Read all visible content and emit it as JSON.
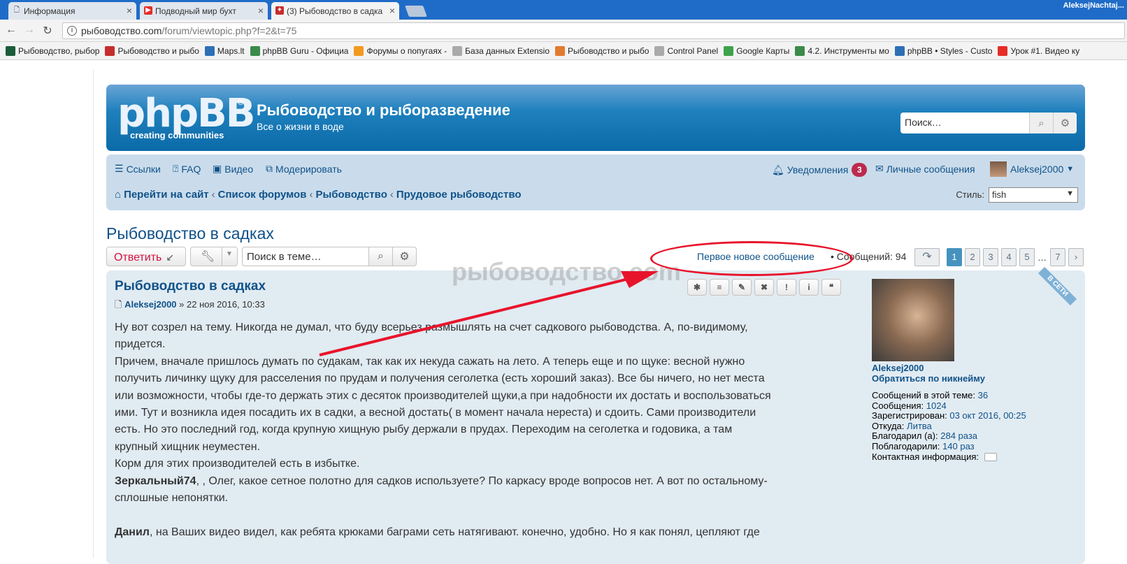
{
  "browser": {
    "tabs": [
      {
        "title": "Информация"
      },
      {
        "title": "Подводный мир бухт"
      },
      {
        "title": "(3) Рыбоводство в садка"
      }
    ],
    "profile_name": "AleksejNachtaj...",
    "url_domain": "рыбоводство.com",
    "url_path": "/forum/viewtopic.php?f=2&t=75"
  },
  "bookmarks": [
    {
      "label": "Рыбоводство, рыбор",
      "color": "#1a5c3a"
    },
    {
      "label": "Рыбоводство и рыбо",
      "color": "#c62d2d"
    },
    {
      "label": "Maps.lt",
      "color": "#2d6fb5"
    },
    {
      "label": "phpBB Guru - Официа",
      "color": "#3a8a4a"
    },
    {
      "label": "Форумы о попугаях -",
      "color": "#f39a1e"
    },
    {
      "label": "База данных Extensio",
      "color": "#aaaaaa"
    },
    {
      "label": "Рыбоводство и рыбо",
      "color": "#e27b2e"
    },
    {
      "label": "Control Panel",
      "color": "#aaaaaa"
    },
    {
      "label": "Google Карты",
      "color": "#3ca34a"
    },
    {
      "label": "4.2. Инструменты мо",
      "color": "#3a8a4a"
    },
    {
      "label": "phpBB • Styles - Custo",
      "color": "#2d6fb5"
    },
    {
      "label": "Урок #1. Видео ку",
      "color": "#e52d27"
    }
  ],
  "header": {
    "logo_text": "phpBB",
    "logo_reg": "®",
    "logo_tagline": "creating communities",
    "site_title": "Рыбоводство и рыборазведение",
    "site_description": "Все о жизни в воде",
    "search_placeholder": "Поиск…"
  },
  "navbar": {
    "links": [
      {
        "label": "Ссылки"
      },
      {
        "label": "FAQ"
      },
      {
        "label": "Видео"
      },
      {
        "label": "Модерировать"
      }
    ],
    "notifications_label": "Уведомления",
    "notifications_count": "3",
    "pm_label": "Личные сообщения",
    "username": "Aleksej2000",
    "breadcrumbs": [
      {
        "label": "Перейти на сайт"
      },
      {
        "label": "Список форумов"
      },
      {
        "label": "Рыбоводство"
      },
      {
        "label": "Прудовое рыбоводство"
      }
    ],
    "style_label": "Стиль:",
    "style_value": "fish"
  },
  "topic": {
    "title": "Рыбоводство в садках",
    "reply_label": "Ответить",
    "search_placeholder": "Поиск в теме…",
    "first_new_label": "Первое новое сообщение",
    "bullet": "•",
    "count_label": "Сообщений: 94",
    "pages": [
      "1",
      "2",
      "3",
      "4",
      "5",
      "…",
      "7"
    ],
    "watermark": "рыбоводство.com"
  },
  "post": {
    "title": "Рыбоводство в садках",
    "author": "Aleksej2000",
    "date": "» 22 ноя 2016, 10:33",
    "buttons": [
      "✱",
      "≡",
      "✎",
      "✖",
      "!",
      "i",
      "❝"
    ],
    "lines": [
      "Ну вот созрел на тему. Никогда не думал, что буду всерьез размышлять на счет садкового рыбоводства. А, по-видимому,",
      "придется.",
      "Причем, вначале пришлось думать по судакам, так как их некуда сажать на лето. А теперь еще и по щуке: весной нужно",
      "получить личинку щуку для расселения по прудам и получения сеголетка (есть хороший заказ). Все бы ничего, но нет места",
      "или возможности, чтобы где-то держать этих с десяток производителей щуки,а при надобности их достать и воспользоваться",
      "ими. Тут и возникла идея посадить их в садки, а весной достать( в момент начала нереста) и сдоить. Сами производители",
      "есть. Но это последний год, когда крупную хищную рыбу держали в прудах. Переходим на сеголетка и годовика, а там",
      "крупный хищник неуместен.",
      "Корм для этих производителей есть в избытке."
    ],
    "bold_1": "Зеркальный74",
    "line_bold_1": ", , Олег, какое сетное полотно для садков используете? По каркасу вроде вопросов нет. А вот по остальному-",
    "line_after_bold_1": "сплошные непонятки.",
    "bold_2": "Данил",
    "line_bold_2": ", на Ваших видео видел, как ребята крюками баграми сеть натягивают. конечно, удобно. Но я как понял, цепляют где"
  },
  "profile": {
    "online_badge": "В СЕТИ",
    "username": "Aleksej2000",
    "contact_link": "Обратиться по никнейму",
    "stats": [
      {
        "label": "Сообщений в этой теме:",
        "value": "36"
      },
      {
        "label": "Сообщения:",
        "value": "1024"
      },
      {
        "label": "Зарегистрирован:",
        "value": "03 окт 2016, 00:25"
      },
      {
        "label": "Откуда:",
        "value": "Литва"
      },
      {
        "label": "Благодарил (а):",
        "value": "284 раза"
      },
      {
        "label": "Поблагодарили:",
        "value": "140 раз"
      },
      {
        "label": "Контактная информация:",
        "value": ""
      }
    ]
  }
}
